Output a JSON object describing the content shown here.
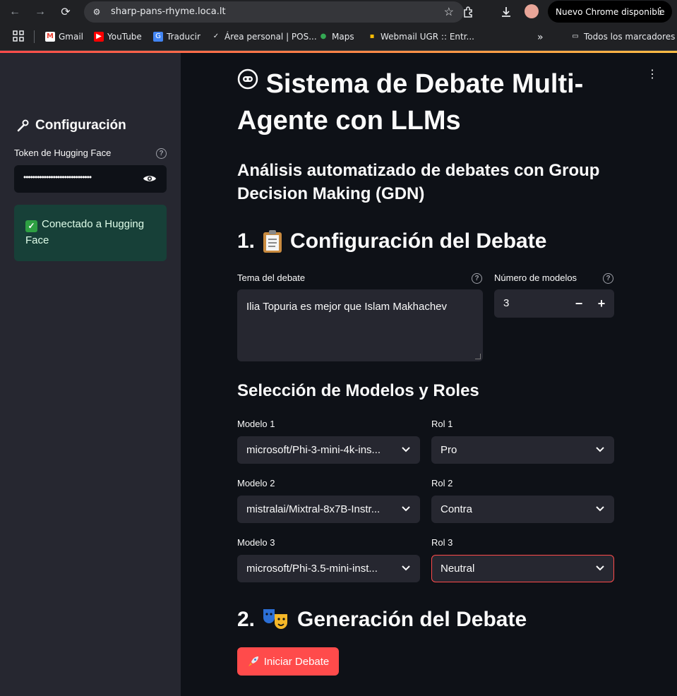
{
  "browser": {
    "url": "sharp-pans-rhyme.loca.lt",
    "update_label": "Nuevo Chrome disponible",
    "bookmarks": [
      {
        "label": "Gmail",
        "icon": "gmail-icon"
      },
      {
        "label": "YouTube",
        "icon": "youtube-icon"
      },
      {
        "label": "Traducir",
        "icon": "translate-icon"
      },
      {
        "label": "Área personal | POS...",
        "icon": "moodle-icon"
      },
      {
        "label": "Maps",
        "icon": "maps-icon"
      },
      {
        "label": "Webmail UGR :: Entr...",
        "icon": "webmail-icon"
      }
    ],
    "all_bookmarks_label": "Todos los marcadores"
  },
  "sidebar": {
    "title": "Configuración",
    "token_label": "Token de Hugging Face",
    "token_value": "••••••••••••••••••••••••••••••",
    "success_message": "Conectado a Hugging Face"
  },
  "main": {
    "title": "Sistema de Debate Multi-Agente con LLMs",
    "subtitle": "Análisis automatizado de debates con Group Decision Making (GDN)",
    "section1": "1. 📋 Configuración del Debate",
    "section1_text": "Configuración del Debate",
    "topic_label": "Tema del debate",
    "topic_value": "Ilia Topuria es mejor que Islam Makhachev",
    "num_models_label": "Número de modelos",
    "num_models_value": "3",
    "models_heading": "Selección de Modelos y Roles",
    "models": [
      {
        "label": "Modelo 1",
        "value": "microsoft/Phi-3-mini-4k-ins...",
        "role_label": "Rol 1",
        "role": "Pro"
      },
      {
        "label": "Modelo 2",
        "value": "mistralai/Mixtral-8x7B-Instr...",
        "role_label": "Rol 2",
        "role": "Contra"
      },
      {
        "label": "Modelo 3",
        "value": "microsoft/Phi-3.5-mini-inst...",
        "role_label": "Rol 3",
        "role": "Neutral"
      }
    ],
    "section2_text": "Generación del Debate",
    "start_button": "Iniciar Debate"
  },
  "colors": {
    "primary": "#ff4b4b",
    "sidebar_bg": "#262730",
    "main_bg": "#0e1117",
    "success_bg": "#174038"
  }
}
